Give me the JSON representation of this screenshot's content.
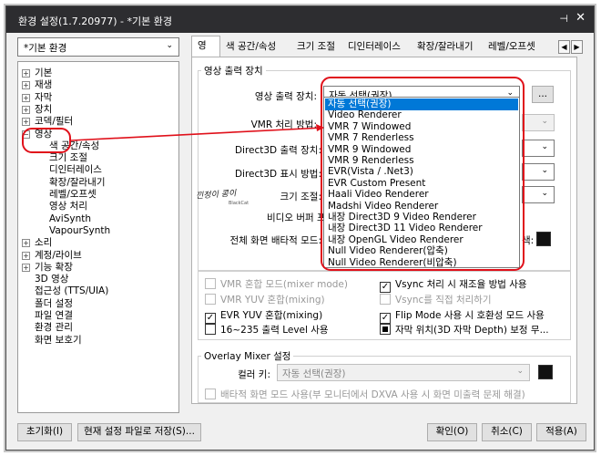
{
  "window": {
    "title": "환경 설정(1.7.20977) - *기본 환경",
    "pin_glyph": "⊣",
    "close_glyph": "✕"
  },
  "profile": {
    "selected": "*기본 환경"
  },
  "tree": {
    "items": [
      {
        "label": "기본",
        "expander": "+"
      },
      {
        "label": "재생",
        "expander": "+"
      },
      {
        "label": "자막",
        "expander": "+"
      },
      {
        "label": "장치",
        "expander": "+"
      },
      {
        "label": "코덱/필터",
        "expander": "+"
      },
      {
        "label": "영상",
        "expander": "−"
      },
      {
        "label": "색 공간/속성",
        "expander": ""
      },
      {
        "label": "크기 조절",
        "expander": ""
      },
      {
        "label": "디인터레이스",
        "expander": ""
      },
      {
        "label": "확장/잘라내기",
        "expander": ""
      },
      {
        "label": "레벨/오프셋",
        "expander": ""
      },
      {
        "label": "영상 처리",
        "expander": ""
      },
      {
        "label": "AviSynth",
        "expander": ""
      },
      {
        "label": "VapourSynth",
        "expander": ""
      },
      {
        "label": "소리",
        "expander": "+"
      },
      {
        "label": "계정/라이브",
        "expander": "+"
      },
      {
        "label": "기능 확장",
        "expander": "+"
      },
      {
        "label": "3D 영상",
        "expander": ""
      },
      {
        "label": "접근성 (TTS/UIA)",
        "expander": ""
      },
      {
        "label": "폴더 설정",
        "expander": ""
      },
      {
        "label": "파일 연결",
        "expander": ""
      },
      {
        "label": "환경 관리",
        "expander": ""
      },
      {
        "label": "화면 보호기",
        "expander": ""
      }
    ]
  },
  "tabs": [
    "영상",
    "색 공간/속성",
    "크기 조절",
    "디인터레이스",
    "확장/잘라내기",
    "레벨/오프셋"
  ],
  "tab_nav": {
    "prev": "◀",
    "next": "▶"
  },
  "video_output": {
    "group_label": "영상 출력 장치",
    "device_label": "영상 출력 장치:",
    "device_value": "자동 선택(권장)",
    "more_button": "...",
    "vmr_label": "VMR 처리 방법:",
    "d3d_output_label": "Direct3D 출력 장치:",
    "d3d_display_label": "Direct3D 표시 방법:",
    "resize_label": "크기 조절:",
    "video_buffer_label": "비디오 버퍼 포맷:",
    "fullscreen_label": "전체 화면 배타적 모드:",
    "fullscreen_suffix": "색:"
  },
  "dropdown": {
    "options": [
      "자동 선택(권장)",
      "Video Renderer",
      "VMR 7 Windowed",
      "VMR 7 Renderless",
      "VMR 9 Windowed",
      "VMR 9 Renderless",
      "EVR(Vista / .Net3)",
      "EVR Custom Present",
      "Haali Video Renderer",
      "Madshi Video Renderer",
      "내장 Direct3D 9 Video Renderer",
      "내장 Direct3D 11 Video Renderer",
      "내장 OpenGL Video Renderer",
      "Null Video Renderer(압축)",
      "Null Video Renderer(비압축)"
    ],
    "selected_index": 0
  },
  "checkboxes": [
    {
      "label": "VMR 혼합 모드(mixer mode)",
      "checked": false,
      "disabled": true
    },
    {
      "label": "Vsync 처리 시 재조율 방법 사용",
      "checked": true,
      "disabled": false
    },
    {
      "label": "VMR YUV 혼합(mixing)",
      "checked": false,
      "disabled": true
    },
    {
      "label": "Vsync를 직접 처리하기",
      "checked": false,
      "disabled": true
    },
    {
      "label": "EVR YUV 혼합(mixing)",
      "checked": true,
      "disabled": false
    },
    {
      "label": "Flip Mode 사용 시 호환성 모드 사용",
      "checked": true,
      "disabled": false
    },
    {
      "label": "16~235 출력 Level 사용",
      "checked": false,
      "disabled": false
    },
    {
      "label": "자막 위치(3D 자막 Depth) 보정 무...",
      "checked": "partial",
      "disabled": false
    }
  ],
  "overlay": {
    "group_label": "Overlay Mixer 설정",
    "color_key_label": "컬러 키:",
    "color_key_value": "자동 선택(권장)",
    "exclusive_label": "배타적 화면 모드 사용(부 모니터에서 DXVA 사용 시 화면 미출력 문제 해결)"
  },
  "watermark": {
    "text": "낀정이 콩이",
    "sub": "BlackCat"
  },
  "buttons": {
    "reset": "초기화(I)",
    "save_preset": "현재 설정 파일로 저장(S)...",
    "ok": "확인(O)",
    "cancel": "취소(C)",
    "apply": "적용(A)"
  },
  "colors": {
    "titlebar": "#2d2d30",
    "highlight": "#0078d7",
    "annotation": "#e0101a"
  }
}
